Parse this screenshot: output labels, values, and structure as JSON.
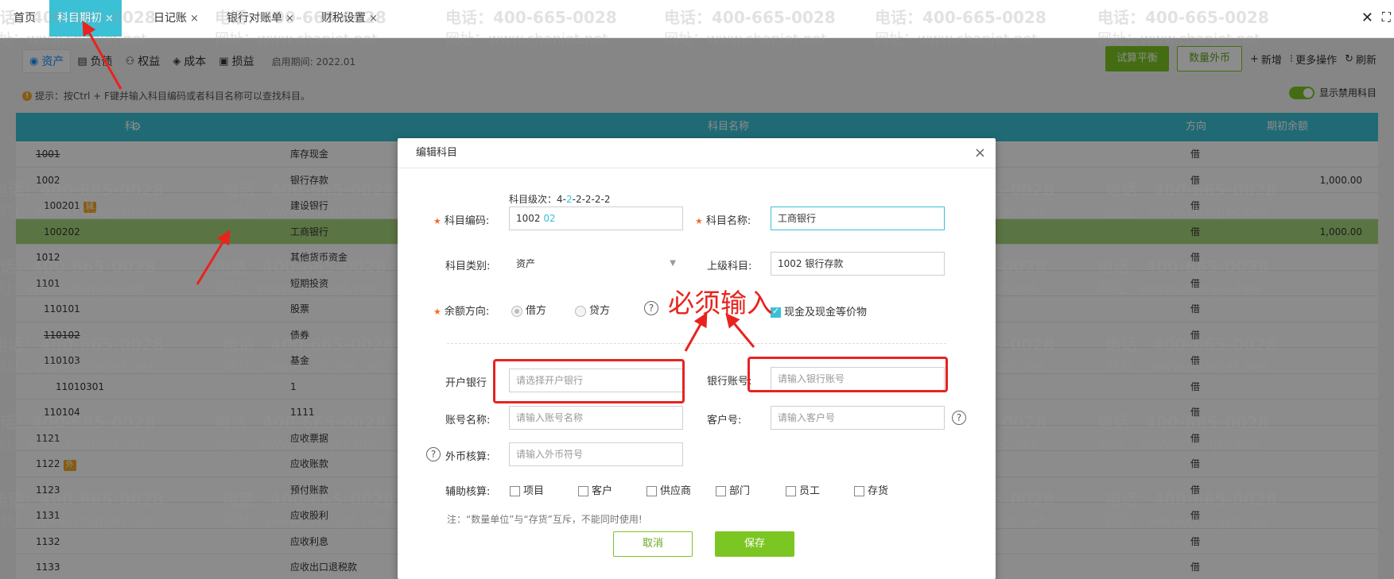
{
  "top_tabs": [
    {
      "label": "首页"
    },
    {
      "label": "科目期初",
      "close": "×"
    },
    {
      "label": "日记账",
      "close": "×"
    },
    {
      "label": "银行对账单",
      "close": "×"
    },
    {
      "label": "财税设置",
      "close": "×"
    }
  ],
  "top_controls": {
    "close": "✕",
    "fullscreen": "⛶"
  },
  "sub_tabs": [
    {
      "label": "资产",
      "icon": "asset-icon"
    },
    {
      "label": "负债",
      "icon": "liability-icon"
    },
    {
      "label": "权益",
      "icon": "equity-icon"
    },
    {
      "label": "成本",
      "icon": "cost-icon"
    },
    {
      "label": "损益",
      "icon": "profit-loss-icon"
    }
  ],
  "period": {
    "label": "启用期间:",
    "value": "2022.01"
  },
  "actions": {
    "trial_balance": "试算平衡",
    "foreign_currency": "数量外币",
    "add": "新增",
    "more": "更多操作",
    "refresh": "刷新"
  },
  "hint": "提示：按Ctrl + F键并输入科目编码或者科目名称可以查找科目。",
  "show_disabled": "显示禁用科目",
  "table": {
    "headers": {
      "code": "科目编码",
      "name": "科目名称",
      "direction": "方向",
      "balance": "期初余额"
    },
    "rows": [
      {
        "code": "1001",
        "name": "库存现金",
        "dir": "借",
        "bal": "",
        "strike": true,
        "indent": 0
      },
      {
        "code": "1002",
        "name": "银行存款",
        "dir": "借",
        "bal": "1,000.00",
        "indent": 0
      },
      {
        "code": "100201",
        "name": "建设银行",
        "dir": "借",
        "bal": "",
        "indent": 1,
        "badge": "辅"
      },
      {
        "code": "100202",
        "name": "工商银行",
        "dir": "借",
        "bal": "1,000.00",
        "indent": 1,
        "selected": true
      },
      {
        "code": "1012",
        "name": "其他货币资金",
        "dir": "借",
        "bal": "",
        "indent": 0
      },
      {
        "code": "1101",
        "name": "短期投资",
        "dir": "借",
        "bal": "",
        "indent": 0
      },
      {
        "code": "110101",
        "name": "股票",
        "dir": "借",
        "bal": "",
        "indent": 1
      },
      {
        "code": "110102",
        "name": "债券",
        "dir": "借",
        "bal": "",
        "indent": 1,
        "strike": true
      },
      {
        "code": "110103",
        "name": "基金",
        "dir": "借",
        "bal": "",
        "indent": 1
      },
      {
        "code": "11010301",
        "name": "1",
        "dir": "借",
        "bal": "",
        "indent": 2
      },
      {
        "code": "110104",
        "name": "1111",
        "dir": "借",
        "bal": "",
        "indent": 1
      },
      {
        "code": "1121",
        "name": "应收票据",
        "dir": "借",
        "bal": "",
        "indent": 0
      },
      {
        "code": "1122",
        "name": "应收账款",
        "dir": "借",
        "bal": "",
        "indent": 0,
        "badge": "外"
      },
      {
        "code": "1123",
        "name": "预付账款",
        "dir": "借",
        "bal": "",
        "indent": 0
      },
      {
        "code": "1131",
        "name": "应收股利",
        "dir": "借",
        "bal": "",
        "indent": 0
      },
      {
        "code": "1132",
        "name": "应收利息",
        "dir": "借",
        "bal": "",
        "indent": 0
      },
      {
        "code": "1133",
        "name": "应收出口退税款",
        "dir": "借",
        "bal": "",
        "indent": 0
      }
    ]
  },
  "watermark": {
    "phone": "电话：400-665-0028",
    "site": "网址：www.chanjet.net"
  },
  "modal": {
    "title": "编辑科目",
    "close": "×",
    "level_label": "科目级次：",
    "level_value": "4-",
    "level_hl": "2",
    "level_rest": "-2-2-2-2",
    "code_label": "科目编码:",
    "code_prefix": "1002",
    "code_suffix": "02",
    "name_label": "科目名称:",
    "name_value": "工商银行",
    "type_label": "科目类别:",
    "type_value": "资产",
    "parent_label": "上级科目:",
    "parent_value": "1002 银行存款",
    "direction_label": "余额方向:",
    "debit": "借方",
    "credit": "贷方",
    "cash_equiv": "现金及现金等价物",
    "bank_label": "开户银行",
    "bank_placeholder": "请选择开户银行",
    "account_no_label": "银行账号:",
    "account_no_placeholder": "请输入银行账号",
    "account_name_label": "账号名称:",
    "account_name_placeholder": "请输入账号名称",
    "customer_no_label": "客户号:",
    "customer_no_placeholder": "请输入客户号",
    "fx_label": "外币核算:",
    "fx_placeholder": "请输入外币符号",
    "aux_label": "辅助核算:",
    "aux_items": [
      "项目",
      "客户",
      "供应商",
      "部门",
      "员工",
      "存货"
    ],
    "note": "注：“数量单位”与“存货”互斥，不能同时使用!",
    "cancel": "取消",
    "save": "保存"
  },
  "annotation": {
    "text": "必须输入",
    "color": "#e8231f"
  },
  "colors": {
    "accent": "#3bc1d6",
    "green": "#7cc623",
    "selected_row": "#a5d67a",
    "annotation": "#e8231f"
  }
}
